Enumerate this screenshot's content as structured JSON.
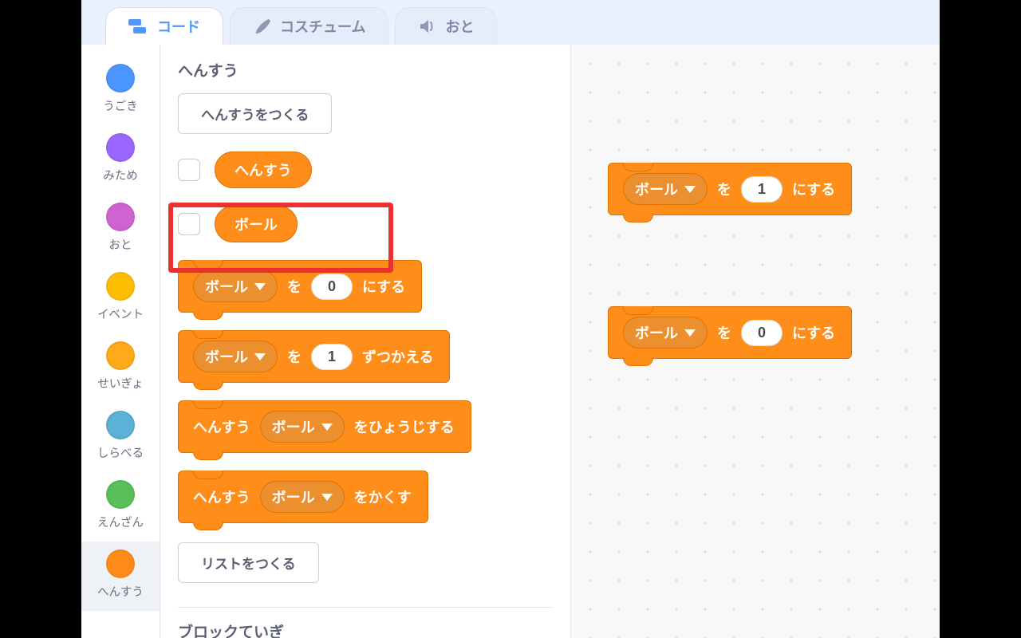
{
  "tabs": {
    "code": "コード",
    "costumes": "コスチューム",
    "sounds": "おと"
  },
  "categories": [
    {
      "key": "motion",
      "label": "うごき",
      "color": "#4c97ff"
    },
    {
      "key": "looks",
      "label": "みため",
      "color": "#9966ff"
    },
    {
      "key": "sound",
      "label": "おと",
      "color": "#cf63cf"
    },
    {
      "key": "events",
      "label": "イベント",
      "color": "#ffbf00"
    },
    {
      "key": "control",
      "label": "せいぎょ",
      "color": "#ffab19"
    },
    {
      "key": "sensing",
      "label": "しらべる",
      "color": "#5cb1d6"
    },
    {
      "key": "operators",
      "label": "えんざん",
      "color": "#59c059"
    },
    {
      "key": "variables",
      "label": "へんすう",
      "color": "#ff8c1a"
    }
  ],
  "selected_category": "variables",
  "palette": {
    "heading": "へんすう",
    "make_var": "へんすうをつくる",
    "vars": [
      {
        "name": "へんすう"
      },
      {
        "name": "ボール"
      }
    ],
    "blocks": {
      "set": {
        "var": "ボール",
        "mid": "を",
        "val": "0",
        "tail": "にする"
      },
      "change": {
        "var": "ボール",
        "mid": "を",
        "val": "1",
        "tail": "ずつかえる"
      },
      "show": {
        "pre": "へんすう",
        "var": "ボール",
        "tail": "をひょうじする"
      },
      "hide": {
        "pre": "へんすう",
        "var": "ボール",
        "tail": "をかくす"
      }
    },
    "make_list": "リストをつくる",
    "blockdef_heading": "ブロックていぎ"
  },
  "canvas_blocks": {
    "b1": {
      "var": "ボール",
      "mid": "を",
      "val": "1",
      "tail": "にする"
    },
    "b2": {
      "var": "ボール",
      "mid": "を",
      "val": "0",
      "tail": "にする"
    }
  },
  "highlight_variable": "ボール"
}
